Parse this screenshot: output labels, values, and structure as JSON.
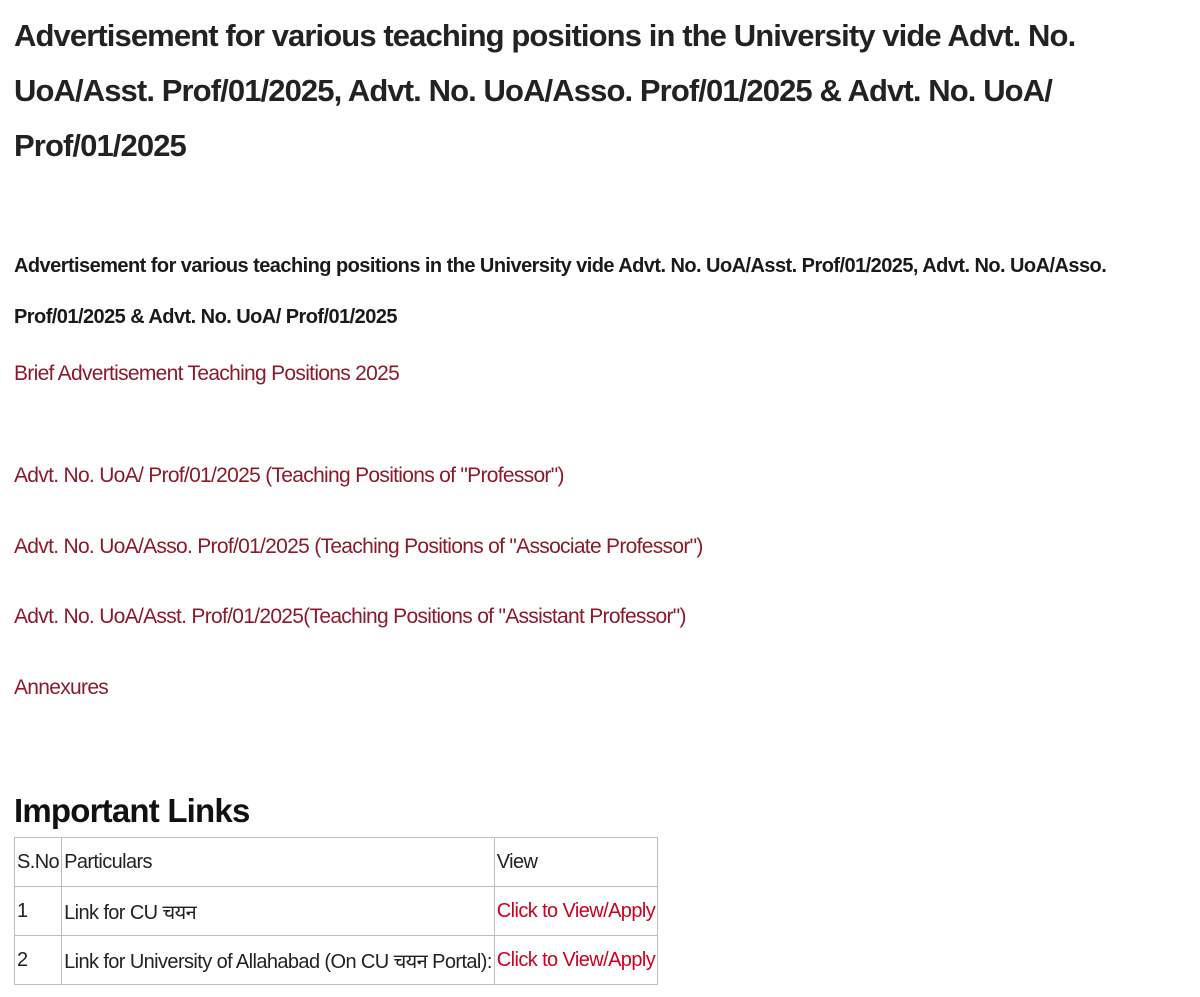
{
  "header": {
    "title": "Advertisement for various teaching positions in the University vide Advt. No. UoA/Asst. Prof/01/2025, Advt. No. UoA/Asso. Prof/01/2025 & Advt. No. UoA/ Prof/01/2025",
    "subtitle": "Advertisement for various teaching positions in the University vide Advt. No. UoA/Asst. Prof/01/2025, Advt. No. UoA/Asso. Prof/01/2025 & Advt. No. UoA/ Prof/01/2025"
  },
  "documents": [
    {
      "label": "Brief Advertisement Teaching Positions 2025"
    },
    {
      "label": "Advt. No. UoA/ Prof/01/2025 (Teaching Positions of \"Professor\")"
    },
    {
      "label": "Advt. No. UoA/Asso. Prof/01/2025 (Teaching Positions of \"Associate Professor\")"
    },
    {
      "label": "Advt. No. UoA/Asst. Prof/01/2025(Teaching Positions  of  \"Assistant Professor\")"
    },
    {
      "label": "Annexures"
    }
  ],
  "important_links": {
    "heading": "Important Links",
    "columns": [
      "S.No",
      "Particulars",
      "View"
    ],
    "rows": [
      {
        "sno": "1",
        "particulars": "Link for CU चयन",
        "view": "Click to View/Apply"
      },
      {
        "sno": "2",
        "particulars": "Link for University of Allahabad (On CU चयन Portal):",
        "view": "Click to View/Apply"
      }
    ]
  },
  "colors": {
    "link": "#8b1a2b",
    "view_link": "#cc0022"
  }
}
